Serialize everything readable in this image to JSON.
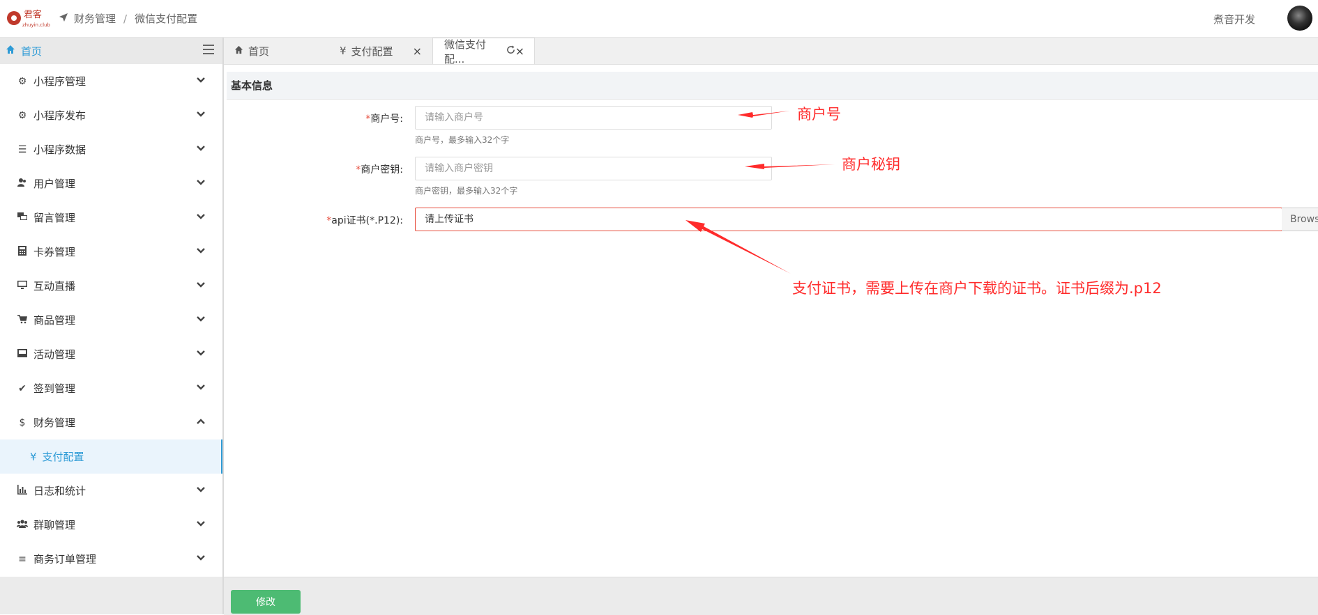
{
  "header": {
    "logo_text": "君客",
    "logo_sub": "zhuyin.club",
    "breadcrumb": [
      "财务管理",
      "微信支付配置"
    ],
    "breadcrumb_sep": "/",
    "username": "煮音开发"
  },
  "sidebar": {
    "home_label": "首页",
    "items": [
      {
        "label": "小程序管理",
        "icon": "gear-icon"
      },
      {
        "label": "小程序发布",
        "icon": "gear-icon"
      },
      {
        "label": "小程序数据",
        "icon": "list-icon"
      },
      {
        "label": "用户管理",
        "icon": "users-icon"
      },
      {
        "label": "留言管理",
        "icon": "messages-icon"
      },
      {
        "label": "卡券管理",
        "icon": "calculator-icon"
      },
      {
        "label": "互动直播",
        "icon": "monitor-icon"
      },
      {
        "label": "商品管理",
        "icon": "cart-icon"
      },
      {
        "label": "活动管理",
        "icon": "inbox-icon"
      },
      {
        "label": "签到管理",
        "icon": "check-icon"
      },
      {
        "label": "财务管理",
        "icon": "dollar-icon"
      },
      {
        "label": "日志和统计",
        "icon": "bar-chart-icon"
      },
      {
        "label": "群聊管理",
        "icon": "group-icon"
      },
      {
        "label": "商务订单管理",
        "icon": "menu-icon"
      }
    ],
    "submenu": {
      "label": "支付配置",
      "icon": "yen-icon"
    }
  },
  "tabs": [
    {
      "label": "首页",
      "icon": "home-icon"
    },
    {
      "label": "支付配置",
      "icon": "yen-icon"
    },
    {
      "label": "微信支付配...",
      "icon": ""
    }
  ],
  "form": {
    "section_title": "基本信息",
    "required_mark": "*",
    "fields": {
      "merchant_id": {
        "label": "商户号:",
        "placeholder": "请输入商户号",
        "help": "商户号，最多输入32个字"
      },
      "merchant_key": {
        "label": "商户密钥:",
        "placeholder": "请输入商户密钥",
        "help": "商户密钥，最多输入32个字"
      },
      "api_cert": {
        "label": "api证书(*.P12):",
        "value": "请上传证书",
        "browse_label": "Browse"
      }
    }
  },
  "annotations": {
    "merchant_id": "商户号",
    "merchant_key": "商户秘钥",
    "cert": "支付证书，需要上传在商户下载的证书。证书后缀为.p12"
  },
  "footer": {
    "submit_label": "修改"
  },
  "colors": {
    "accent": "#2e9bd6",
    "submit": "#4dbb73",
    "annotation": "#ff2b2b",
    "required": "#e74c3c"
  }
}
